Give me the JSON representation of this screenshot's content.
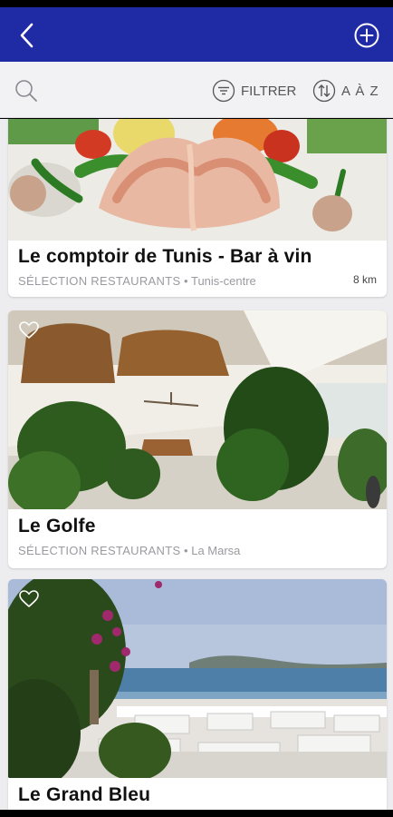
{
  "header": {
    "back_icon": "chevron-left-icon",
    "add_icon": "plus-circle-icon",
    "bg_color": "#1f2aa5"
  },
  "toolbar": {
    "search_icon": "search-icon",
    "filter_label": "FILTRER",
    "sort_label": "A À Z"
  },
  "restaurants": [
    {
      "name": "Le comptoir de Tunis - Bar à vin",
      "category": "SÉLECTION RESTAURANTS",
      "location": "Tunis-centre",
      "distance": "8 km"
    },
    {
      "name": "Le Golfe",
      "category": "SÉLECTION RESTAURANTS",
      "location": "La Marsa"
    },
    {
      "name": "Le Grand Bleu"
    }
  ]
}
